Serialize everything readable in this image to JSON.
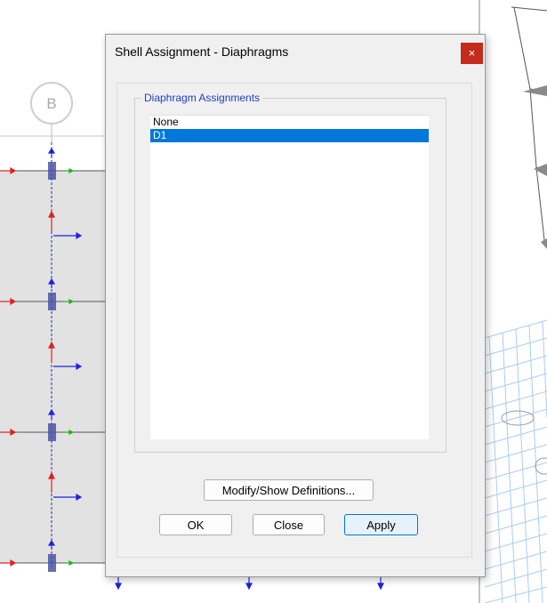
{
  "background": {
    "grid_label": "B"
  },
  "dialog": {
    "title": "Shell Assignment - Diaphragms",
    "close_glyph": "×",
    "group_title": "Diaphragm Assignments",
    "list_items": [
      "None",
      "D1"
    ],
    "selected_item": "D1",
    "buttons": {
      "modify": "Modify/Show Definitions...",
      "ok": "OK",
      "close": "Close",
      "apply": "Apply"
    }
  },
  "colors": {
    "accent": "#0078d7",
    "close_button": "#c42b1c",
    "group_title": "#1f3fbf"
  }
}
